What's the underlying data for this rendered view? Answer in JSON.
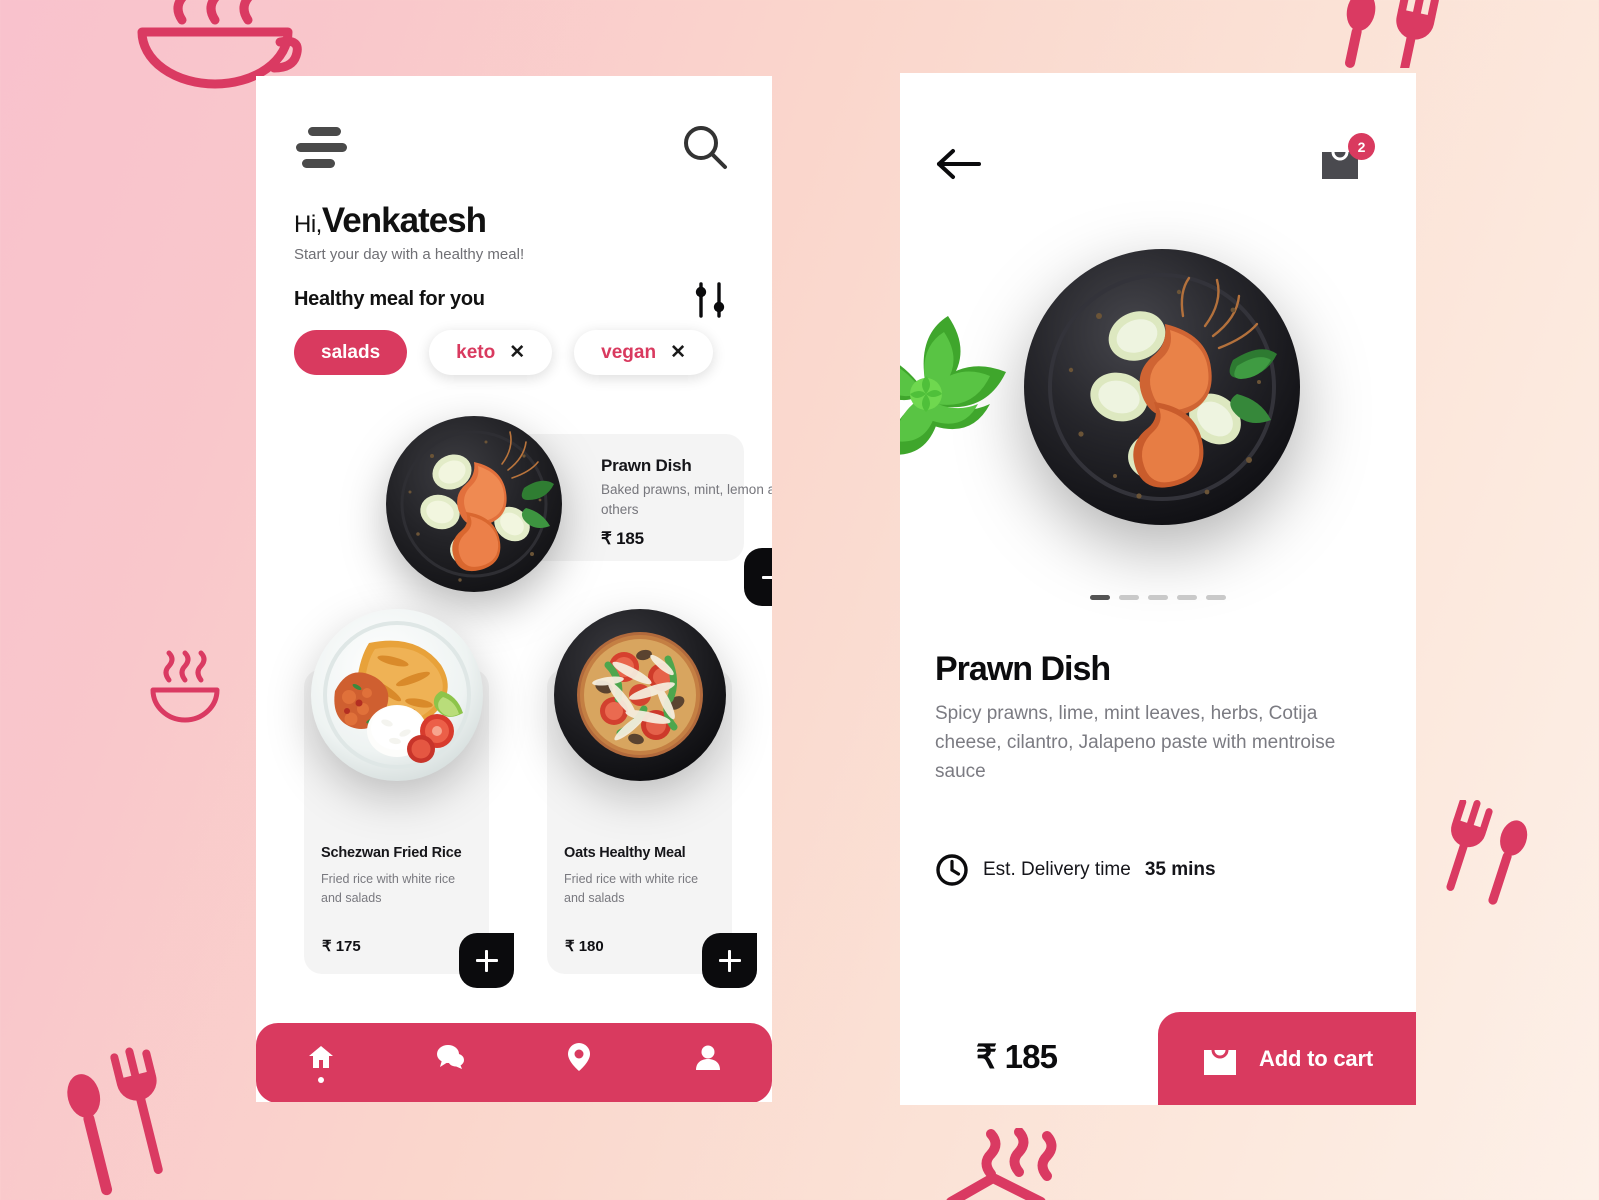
{
  "theme": {
    "accent": "#D93A5F",
    "dark": "#0B0B0D",
    "card_bg": "#F4F4F4",
    "muted_text": "#79797F",
    "bg_left": "#F9C2CD",
    "bg_right": "#FDF0E8"
  },
  "home": {
    "menu_icon": "hamburger-icon",
    "search_icon": "search-icon",
    "greeting_prefix": "Hi,",
    "user_name": "Venkatesh",
    "subtitle": "Start your day with a healthy meal!",
    "section_title": "Healthy meal for you",
    "filter_icon": "sliders-icon",
    "chips": [
      {
        "label": "salads",
        "active": true,
        "removable": false
      },
      {
        "label": "keto",
        "active": false,
        "removable": true,
        "close": "✕"
      },
      {
        "label": "vegan",
        "active": false,
        "removable": true,
        "close": "✕"
      }
    ],
    "featured": {
      "name": "Prawn Dish",
      "description": "Baked prawns, mint, lemon and others",
      "price": "₹ 185",
      "add_label": "+",
      "image": "prawn-plate-photo"
    },
    "items": [
      {
        "name": "Schezwan Fried Rice",
        "description": "Fried rice with white rice and salads",
        "price": "₹ 175",
        "image": "fried-rice-plate-photo"
      },
      {
        "name": "Oats Healthy Meal",
        "description": "Fried rice with white rice and salads",
        "price": "₹ 180",
        "image": "oats-meal-pan-photo"
      }
    ],
    "nav": [
      {
        "icon": "home-icon",
        "active": true
      },
      {
        "icon": "chat-icon",
        "active": false
      },
      {
        "icon": "location-pin-icon",
        "active": false
      },
      {
        "icon": "user-icon",
        "active": false
      }
    ]
  },
  "detail": {
    "back_icon": "arrow-left-icon",
    "cart_icon": "shopping-bag-icon",
    "cart_count": "2",
    "hero_image": "prawn-plate-photo",
    "mint_image": "mint-leaves-photo",
    "carousel": {
      "total": 5,
      "active_index": 0
    },
    "title": "Prawn Dish",
    "description": "Spicy prawns, lime, mint leaves, herbs, Cotija cheese, cilantro, Jalapeno paste with mentroise sauce",
    "eta_icon": "clock-icon",
    "eta_label": "Est. Delivery time",
    "eta_value": "35 mins",
    "price": "₹ 185",
    "cart_button_label": "Add to cart",
    "cart_button_icon": "shopping-bag-icon"
  },
  "decorations": [
    {
      "name": "bowl-steam-outline-icon",
      "position": "top-left"
    },
    {
      "name": "spoon-fork-icon",
      "position": "top-right"
    },
    {
      "name": "bowl-steam-outline-icon",
      "position": "mid-left"
    },
    {
      "name": "spoon-fork-icon",
      "position": "bottom-left"
    },
    {
      "name": "spoon-fork-icon",
      "position": "mid-right"
    },
    {
      "name": "steam-lines-icon",
      "position": "bottom-center"
    }
  ]
}
